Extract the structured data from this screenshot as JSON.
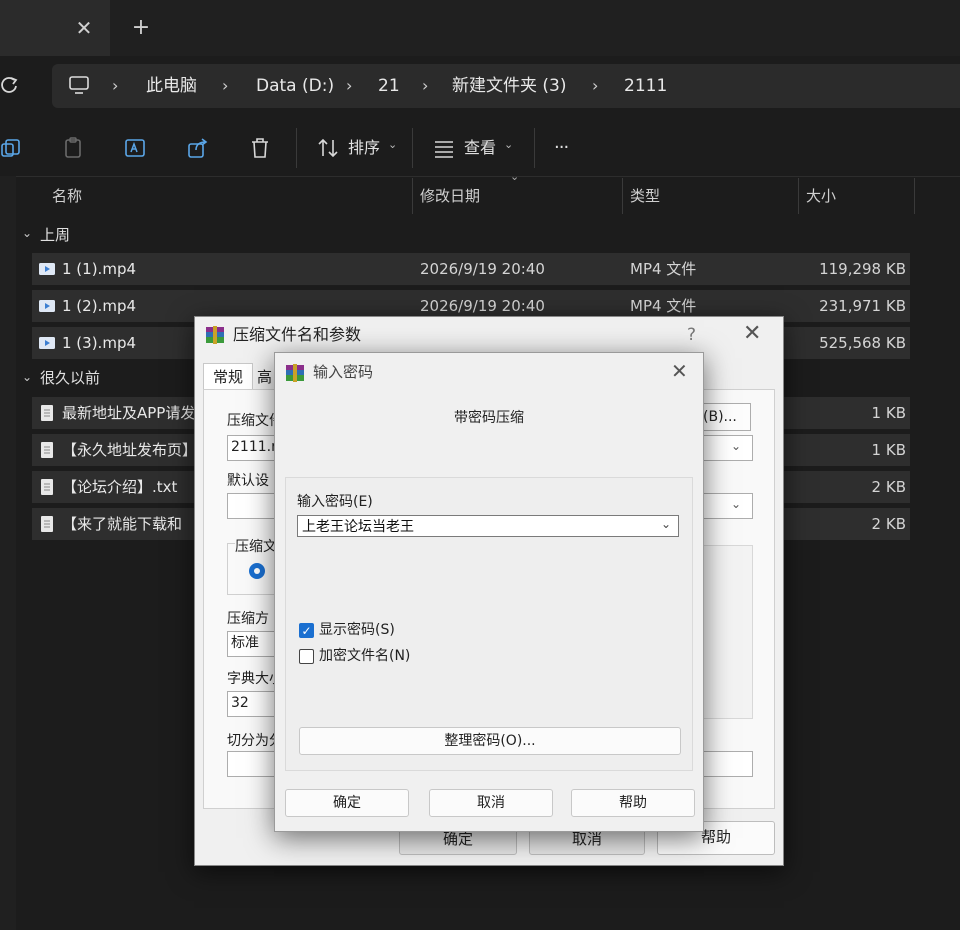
{
  "explorer": {
    "new_tab_symbol": "+",
    "tab_close_symbol": "✕",
    "breadcrumbs": [
      "此电脑",
      "Data (D:)",
      "21",
      "新建文件夹 (3)",
      "2111"
    ],
    "breadcrumb_sep": "›",
    "toolbar": {
      "sort_label": "排序",
      "view_label": "查看",
      "more_label": "···"
    },
    "columns": {
      "name": "名称",
      "modified": "修改日期",
      "type": "类型",
      "size": "大小"
    },
    "groups": [
      {
        "label": "上周",
        "rows": [
          {
            "name": "1 (1).mp4",
            "modified": "2026/9/19 20:40",
            "type": "MP4 文件",
            "size": "119,298 KB",
            "icon": "video-file-icon"
          },
          {
            "name": "1 (2).mp4",
            "modified": "2026/9/19 20:40",
            "type": "MP4 文件",
            "size": "231,971 KB",
            "icon": "video-file-icon"
          },
          {
            "name": "1 (3).mp4",
            "modified": "",
            "type": "",
            "size": "525,568 KB",
            "icon": "video-file-icon"
          }
        ]
      },
      {
        "label": "很久以前",
        "rows": [
          {
            "name": "最新地址及APP请发",
            "size": "1 KB",
            "icon": "text-file-icon"
          },
          {
            "name": "【永久地址发布页】",
            "size": "1 KB",
            "icon": "text-file-icon"
          },
          {
            "name": "【论坛介绍】.txt",
            "size": "2 KB",
            "icon": "text-file-icon"
          },
          {
            "name": "【来了就能下载和",
            "size": "2 KB",
            "icon": "text-file-icon"
          }
        ]
      }
    ]
  },
  "archive_dialog": {
    "title": "压缩文件名和参数",
    "help_symbol": "?",
    "close_symbol": "✕",
    "tab_general": "常规",
    "tab_partial": "高",
    "archive_name_label": "压缩文件",
    "archive_name_value": "2111.r",
    "browse_button": "(B)...",
    "default_settings_label": "默认设",
    "format_group_label": "压缩文",
    "method_label": "压缩方",
    "method_value": "标准",
    "dict_label": "字典大小",
    "dict_value": "32",
    "split_label": "切分为分",
    "ok_button": "确定",
    "cancel_button": "取消",
    "help_button": "帮助"
  },
  "password_dialog": {
    "title": "输入密码",
    "close_symbol": "✕",
    "subtitle": "带密码压缩",
    "password_label": "输入密码(E)",
    "password_value": "上老王论坛当老王",
    "show_password_label": "显示密码(S)",
    "show_password_checked": true,
    "encrypt_names_label": "加密文件名(N)",
    "encrypt_names_checked": false,
    "organize_button": "整理密码(O)...",
    "ok_button": "确定",
    "cancel_button": "取消",
    "help_button": "帮助"
  },
  "colors": {
    "accent": "#1a6fd0",
    "explorer_bg": "#1c1c1c",
    "row_bg": "#2e2e2e"
  }
}
